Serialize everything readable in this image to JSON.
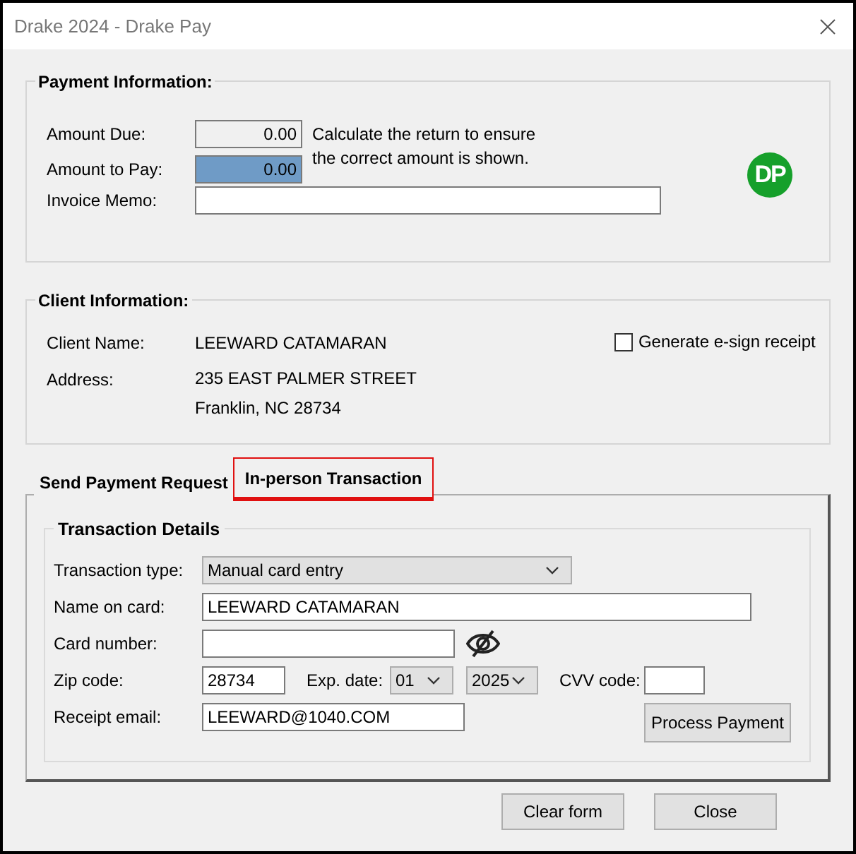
{
  "window": {
    "title": "Drake 2024 - Drake Pay"
  },
  "payment_information": {
    "title": "Payment Information:",
    "amount_due": {
      "label": "Amount Due:",
      "value": "0.00"
    },
    "amount_to_pay": {
      "label": "Amount to Pay:",
      "value": "0.00",
      "selected": true
    },
    "note": "Calculate the return to ensure the correct amount is shown.",
    "invoice_memo": {
      "label": "Invoice Memo:"
    },
    "logo": "DP"
  },
  "client_information": {
    "title": "Client Information:",
    "name": {
      "label": "Client Name:",
      "value": "LEEWARD CATAMARAN"
    },
    "address": {
      "label": "Address:",
      "lines": [
        "235 EAST PALMER STREET",
        "Franklin, NC 28734"
      ]
    },
    "esign": {
      "label": "Generate e-sign receipt",
      "checked": false
    }
  },
  "tabs": [
    {
      "label": "Send Payment Request",
      "selected": false,
      "highlighted": false
    },
    {
      "label": "In-person Transaction",
      "selected": true,
      "highlighted": true
    }
  ],
  "transaction_details": {
    "title": "Transaction Details",
    "transaction_type": {
      "label": "Transaction type:",
      "value": "Manual card entry"
    },
    "name_on_card": {
      "label": "Name on card:",
      "value": "LEEWARD CATAMARAN"
    },
    "card_number": {
      "label": "Card number:"
    },
    "zip_code": {
      "label": "Zip code:",
      "value": "28734"
    },
    "exp_date": {
      "label": "Exp. date:",
      "month": "01",
      "year": "2025"
    },
    "cvv_code": {
      "label": "CVV code:"
    },
    "receipt_email": {
      "label": "Receipt email:",
      "value": "LEEWARD@1040.COM"
    },
    "process_button": "Process Payment"
  },
  "buttons": [
    "Clear form",
    "Close"
  ]
}
